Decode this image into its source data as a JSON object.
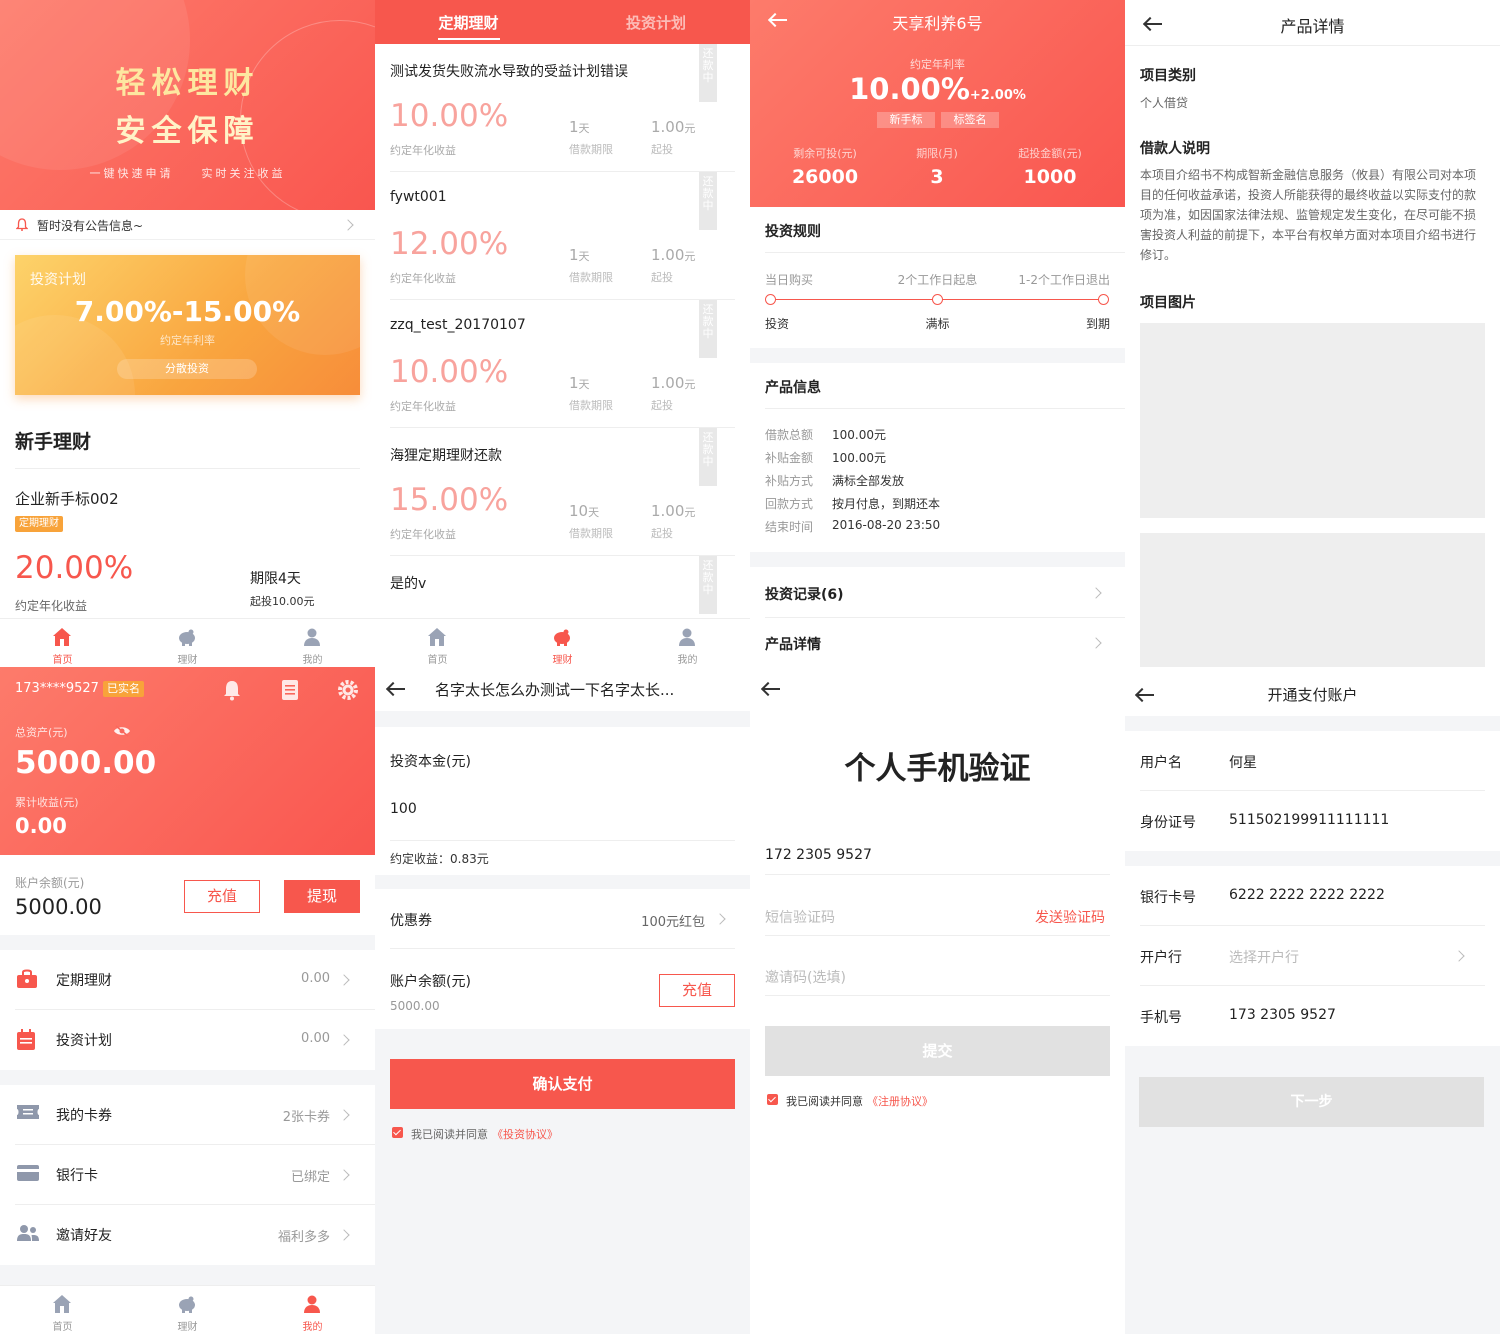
{
  "home": {
    "banner_line1": "轻松理财",
    "banner_line2": "安全保障",
    "banner_sub": "一键快速申请　　实时关注收益",
    "notice": "暂时没有公告信息~",
    "plan_card": {
      "title": "投资计划",
      "rate": "7.00%-15.00%",
      "rate_label": "约定年利率",
      "button": "分散投资"
    },
    "section_title": "新手理财",
    "product": {
      "name": "企业新手标002",
      "tag": "定期理财",
      "rate": "20.00%",
      "rate_label": "约定年化收益",
      "term": "期限4天",
      "min": "起投10.00元"
    }
  },
  "tabbar": {
    "home": "首页",
    "finance": "理财",
    "mine": "我的"
  },
  "list": {
    "tab_fixed": "定期理财",
    "tab_plan": "投资计划",
    "stamp": "还款中",
    "rate_label": "约定年化收益",
    "term_label": "借款期限",
    "min_label": "起投",
    "items": [
      {
        "name": "测试发货失败流水导致的受益计划错误",
        "rate": "10.00%",
        "term": "1",
        "term_unit": "天",
        "min": "1.00",
        "min_unit": "元"
      },
      {
        "name": "fywt001",
        "rate": "12.00%",
        "term": "1",
        "term_unit": "天",
        "min": "1.00",
        "min_unit": "元"
      },
      {
        "name": "zzq_test_20170107",
        "rate": "10.00%",
        "term": "1",
        "term_unit": "天",
        "min": "1.00",
        "min_unit": "元"
      },
      {
        "name": "海狸定期理财还款",
        "rate": "15.00%",
        "term": "10",
        "term_unit": "天",
        "min": "1.00",
        "min_unit": "元"
      },
      {
        "name": "是的v"
      }
    ]
  },
  "detail": {
    "title": "天享利养6号",
    "rate_label": "约定年利率",
    "rate": "10.00%",
    "rate_extra": "+2.00%",
    "tags": [
      "新手标",
      "标签名"
    ],
    "stats": [
      {
        "label": "剩余可投(元)",
        "value": "26000"
      },
      {
        "label": "期限(月)",
        "value": "3"
      },
      {
        "label": "起投金额(元)",
        "value": "1000"
      }
    ],
    "rules_title": "投资规则",
    "steps_top": [
      "当日购买",
      "2个工作日起息",
      "1-2个工作日退出"
    ],
    "steps_bottom": [
      "投资",
      "满标",
      "到期"
    ],
    "info_title": "产品信息",
    "info": [
      {
        "k": "借款总额",
        "v": "100.00元"
      },
      {
        "k": "补贴金额",
        "v": "100.00元"
      },
      {
        "k": "补贴方式",
        "v": "满标全部发放"
      },
      {
        "k": "回款方式",
        "v": "按月付息，到期还本"
      },
      {
        "k": "结束时间",
        "v": "2016-08-20  23:50"
      }
    ],
    "records": "投资记录(6)",
    "product_detail": "产品详情"
  },
  "pdetail": {
    "title": "产品详情",
    "category_title": "项目类别",
    "category": "个人借贷",
    "desc_title": "借款人说明",
    "desc": "本项目介绍书不构成智新金融信息服务（攸县）有限公司对本项目的任何收益承诺，投资人所能获得的最终收益以实际支付的款项为准，如因国家法律法规、监管规定发生变化，在尽可能不损害投资人利益的前提下，本平台有权单方面对本项目介绍书进行修订。",
    "image_title": "项目图片"
  },
  "mine": {
    "phone": "173****9527",
    "verified": "已实名",
    "assets_label": "总资产(元)",
    "assets": "5000.00",
    "income_label": "累计收益(元)",
    "income": "0.00",
    "balance_label": "账户余额(元)",
    "balance": "5000.00",
    "recharge": "充值",
    "withdraw": "提现",
    "rows": [
      {
        "label": "定期理财",
        "value": "0.00"
      },
      {
        "label": "投资计划",
        "value": "0.00"
      },
      {
        "label": "我的卡券",
        "value": "2张卡券"
      },
      {
        "label": "银行卡",
        "value": "已绑定"
      },
      {
        "label": "邀请好友",
        "value": "福利多多"
      }
    ]
  },
  "pay": {
    "title": "名字太长怎么办测试一下名字太长...",
    "principal_label": "投资本金(元)",
    "principal": "100",
    "expected": "约定收益：0.83元",
    "coupon_label": "优惠券",
    "coupon_value": "100元红包",
    "balance_label": "账户余额(元)",
    "balance": "5000.00",
    "recharge": "充值",
    "confirm": "确认支付",
    "agree": "我已阅读并同意",
    "agreement": "《投资协议》"
  },
  "verify": {
    "title": "个人手机验证",
    "phone": "172 2305 9527",
    "sms_placeholder": "短信验证码",
    "send_code": "发送验证码",
    "invite_placeholder": "邀请码(选填)",
    "submit": "提交",
    "agree": "我已阅读并同意",
    "agreement": "《注册协议》"
  },
  "account": {
    "title": "开通支付账户",
    "rows": [
      {
        "label": "用户名",
        "value": "何星"
      },
      {
        "label": "身份证号",
        "value": "511502199911111111"
      },
      {
        "label": "银行卡号",
        "value": "6222 2222 2222 2222"
      },
      {
        "label": "开户行",
        "value": "选择开户行"
      },
      {
        "label": "手机号",
        "value": "173 2305 9527"
      }
    ],
    "next": "下一步"
  },
  "colors": {
    "accent": "#f7574d",
    "orange": "#f8a33a",
    "pink_text": "#f8a39d"
  }
}
